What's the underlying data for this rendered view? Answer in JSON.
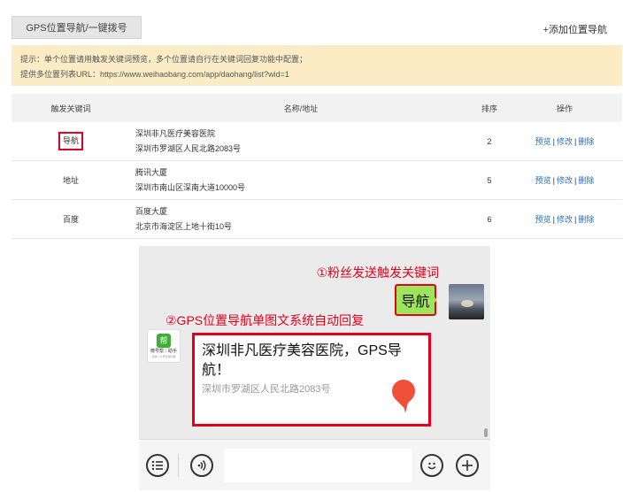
{
  "header": {
    "tab_label": "GPS位置导航/一键拨号",
    "add_label": "+添加位置导航"
  },
  "tips": {
    "line1": "提示：单个位置请用触发关键词预览，多个位置请自行在关键词回复功能中配置；",
    "line2": "提供多位置列表URL：https://www.weihaobang.com/app/daohang/list?wid=1"
  },
  "table": {
    "headers": [
      "触发关键词",
      "名称/地址",
      "排序",
      "操作"
    ],
    "rows": [
      {
        "keyword": "导航",
        "name": "深圳非凡医疗美容医院",
        "address": "深圳市罗湖区人民北路2083号",
        "order": "2",
        "highlighted": true
      },
      {
        "keyword": "地址",
        "name": "腾讯大厦",
        "address": "深圳市南山区深南大道10000号",
        "order": "5",
        "highlighted": false
      },
      {
        "keyword": "百度",
        "name": "百度大厦",
        "address": "北京市海淀区上地十街10号",
        "order": "6",
        "highlighted": false
      }
    ],
    "actions": {
      "preview": "预览",
      "edit": "修改",
      "delete": "删除",
      "separator": "|"
    }
  },
  "chat": {
    "annotation_1": "①粉丝发送触发关键词",
    "annotation_2": "②GPS位置导航单图文系统自动回复",
    "user_message": "导航",
    "bot_avatar": {
      "badge": "帮",
      "name": "微号帮｜助手",
      "tagline": "微信公众号营销利器"
    },
    "card": {
      "title": "深圳非凡医疗美容医院，GPS导航！",
      "description": "深圳市罗湖区人民北路2083号"
    },
    "accent_color": "#e3001b",
    "bubble_color": "#9fe55c"
  },
  "input_bar": {
    "menu_icon": "menu-icon",
    "voice_icon": "voice-icon",
    "emoji_icon": "emoji-icon",
    "plus_icon": "plus-icon"
  }
}
